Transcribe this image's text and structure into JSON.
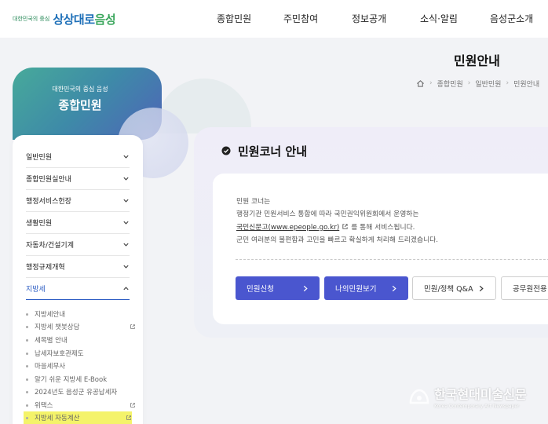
{
  "header": {
    "logo_tagline": "대한민국의 중심",
    "logo_text_a": "상상대로",
    "logo_text_b": "음성",
    "nav": [
      "종합민원",
      "주민참여",
      "정보공개",
      "소식·알림",
      "음성군소개"
    ]
  },
  "page": {
    "title": "민원안내",
    "breadcrumb": [
      "종합민원",
      "일반민원",
      "민원안내"
    ]
  },
  "banner": {
    "subtitle": "대한민국의 중심 음성",
    "title": "종합민원"
  },
  "sidebar": {
    "items": [
      {
        "label": "일반민원",
        "expanded": false
      },
      {
        "label": "종합민원실안내",
        "expanded": false
      },
      {
        "label": "행정서비스헌장",
        "expanded": false
      },
      {
        "label": "생활민원",
        "expanded": false
      },
      {
        "label": "자동차/건설기계",
        "expanded": false
      },
      {
        "label": "행정규제개혁",
        "expanded": false
      },
      {
        "label": "지방세",
        "expanded": true
      }
    ],
    "subitems": [
      {
        "label": "지방세안내",
        "external": false,
        "highlighted": false
      },
      {
        "label": "지방세 챗봇상담",
        "external": true,
        "highlighted": false
      },
      {
        "label": "세목별 안내",
        "external": false,
        "highlighted": false
      },
      {
        "label": "납세자보호관제도",
        "external": false,
        "highlighted": false
      },
      {
        "label": "마을세무사",
        "external": false,
        "highlighted": false
      },
      {
        "label": "알기 쉬운 지방세 E-Book",
        "external": false,
        "highlighted": false
      },
      {
        "label": "2024년도 음성군 유공납세자",
        "external": false,
        "highlighted": false
      },
      {
        "label": "위택스",
        "external": true,
        "highlighted": false
      },
      {
        "label": "지방세 자동계산",
        "external": true,
        "highlighted": true
      }
    ]
  },
  "content": {
    "title": "민원코너 안내",
    "line1": "민원 코너는",
    "line2": "행정기관 민원서비스 통합에 따라 국민권익위원회에서 운영하는",
    "line3_link": "국민신문고(www.epeople.go.kr)",
    "line3_rest": "를 통해 서비스됩니다.",
    "line4": "군민 여러분의 불편함과 고민을 빠르고 확실하게 처리해 드리겠습니다.",
    "buttons": [
      {
        "label": "민원신청",
        "style": "primary"
      },
      {
        "label": "나의민원보기",
        "style": "primary"
      },
      {
        "label": "민원/정책 Q&A",
        "style": "outline"
      },
      {
        "label": "공무원전용",
        "style": "outline"
      }
    ]
  },
  "watermark": {
    "main": "한국현대미술신문",
    "sub": "Korea Contemporary Art Newspaper"
  },
  "colors": {
    "primary_button": "#4a56cf",
    "active_menu": "#2f5fc4",
    "highlight": "#f4f36a"
  }
}
